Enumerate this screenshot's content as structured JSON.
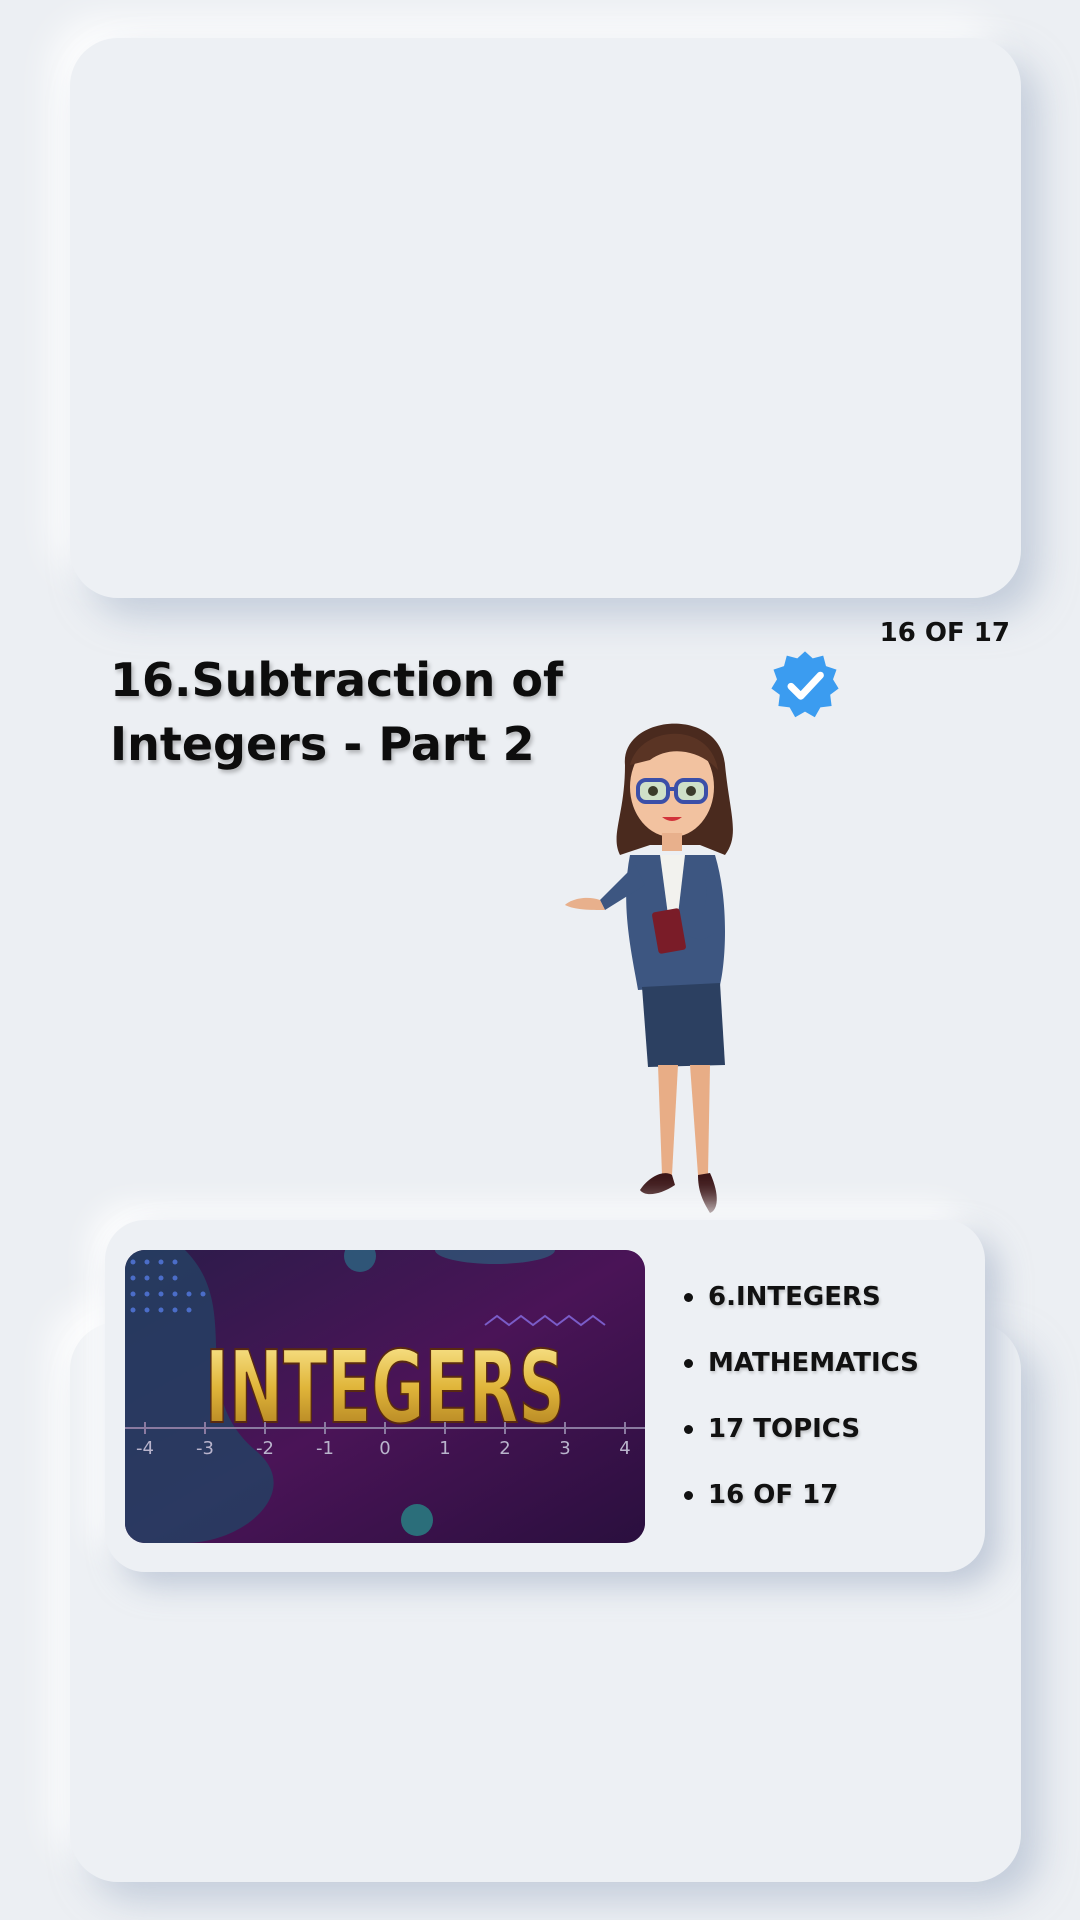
{
  "lesson": {
    "title": "16.Subtraction of Integers - Part 2",
    "counter": "16 OF 17"
  },
  "icons": {
    "verified": "verified-badge-icon",
    "verified_color": "#3b9cf0"
  },
  "thumbnail": {
    "heading": "INTEGERS",
    "number_line": [
      "-4",
      "-3",
      "-2",
      "-1",
      "0",
      "1",
      "2",
      "3",
      "4"
    ]
  },
  "facts": [
    "6.INTEGERS",
    "MATHEMATICS",
    "17 TOPICS",
    "16 OF 17"
  ]
}
